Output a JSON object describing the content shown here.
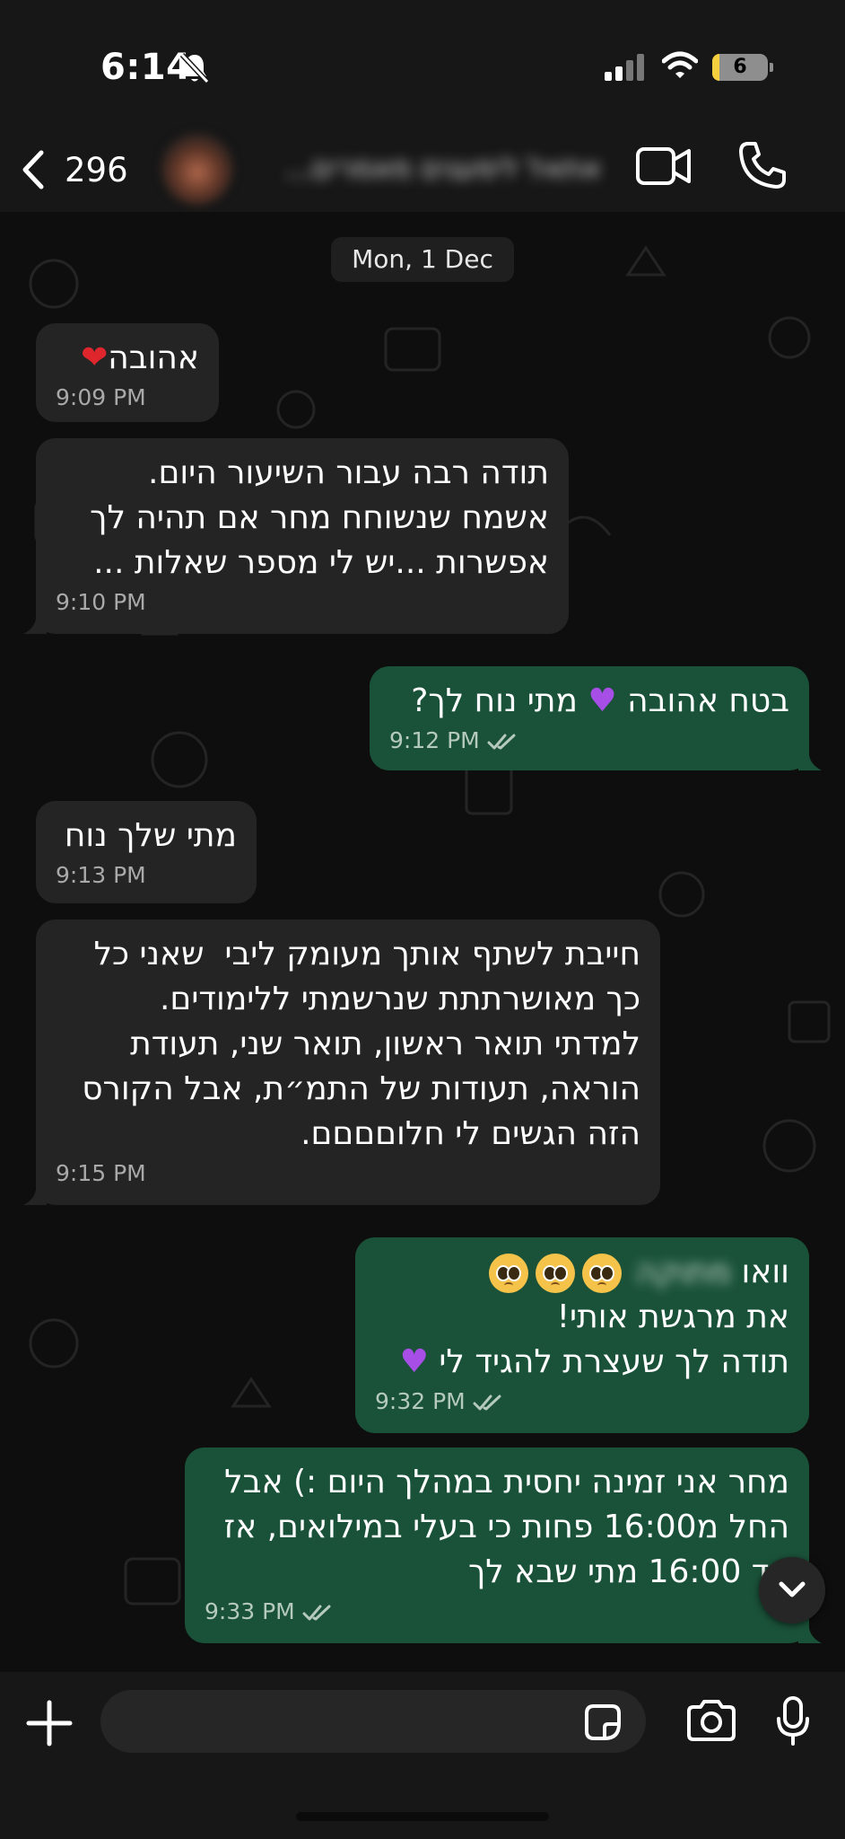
{
  "status_bar": {
    "time": "6:14",
    "battery_level": "6"
  },
  "header": {
    "unread_count": "296",
    "contact_name": "אתאל לימעגים מאמרים..."
  },
  "chat": {
    "date_chip": "Mon, 1 Dec",
    "messages": [
      {
        "dir": "in",
        "text": "אהובה",
        "emoji": "❤️",
        "time": "9:09 PM"
      },
      {
        "dir": "in",
        "text": "תודה רבה עבור השיעור היום.\nאשמח שנשוחח מחר אם תהיה לך\nאפשרות ...יש לי מספר שאלות ...",
        "time": "9:10 PM"
      },
      {
        "dir": "out",
        "text_a": "בטח אהובה",
        "emoji": "💜",
        "text_b": "מתי נוח לך?",
        "time": "9:12 PM"
      },
      {
        "dir": "in",
        "text": "מתי שלך נוח",
        "time": "9:13 PM"
      },
      {
        "dir": "in",
        "text": "חייבת לשתף אותך מעומק ליבי  שאני כל\nכך מאושרתתת שנרשמתי ללימודים.\nלמדתי תואר ראשון, תואר שני, תעודת\nהוראה, תעודות של התמ״ת, אבל הקורס\nהזה הגשים לי חלוםםםם.",
        "time": "9:15 PM"
      },
      {
        "dir": "out",
        "line1_word": "וואו",
        "line1_name": "מתוקה",
        "line2": "את מרגשת אותי!",
        "line3": "תודה לך שעצרת להגיד לי",
        "emoji": "💜",
        "time": "9:32 PM"
      },
      {
        "dir": "out",
        "text": "מחר אני זמינה יחסית במהלך היום :) אבל\nהחל מ16:00 פחות כי בעלי במילואים, אז\nעד 16:00 מתי שבא לך",
        "time": "9:33 PM"
      }
    ]
  },
  "input": {
    "placeholder": "",
    "value": ""
  },
  "colors": {
    "incoming_bubble": "#242424",
    "outgoing_bubble": "#1a5239",
    "background": "#0e0e0e"
  }
}
